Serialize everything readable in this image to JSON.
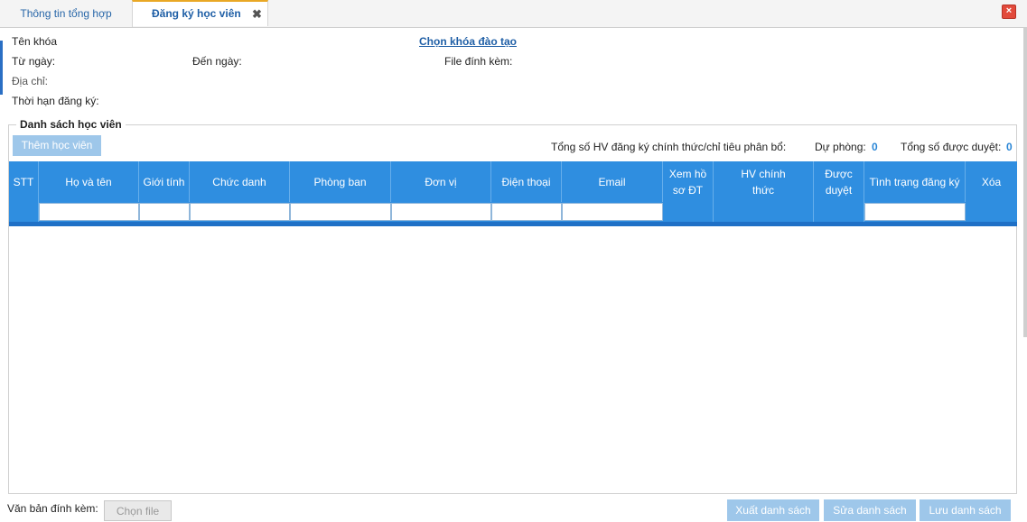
{
  "tabs": [
    {
      "label": "Thông tin tổng hợp"
    },
    {
      "label": "Đăng ký học viên"
    }
  ],
  "icons": {
    "tab_close": "close-icon",
    "window_close": "window-close-icon"
  },
  "info": {
    "course_label": "Tên khóa",
    "choose_course_link": "Chọn khóa đào tạo",
    "from_date_label": "Từ ngày:",
    "to_date_label": "Đến ngày:",
    "attachment_label": "File đính kèm:",
    "address_label": "Địa chỉ:",
    "deadline_label": "Thời hạn đăng ký:"
  },
  "student_list": {
    "legend": "Danh sách học viên",
    "add_button": "Thêm học viên",
    "summary": {
      "official_label": "Tổng số HV đăng ký chính thức/chỉ tiêu phân bổ:",
      "reserve_label": "Dự phòng:",
      "reserve_value": "0",
      "approved_label": "Tổng số được duyệt:",
      "approved_value": "0"
    },
    "columns": [
      "STT",
      "Họ và tên",
      "Giới tính",
      "Chức danh",
      "Phòng ban",
      "Đơn vị",
      "Điện thoại",
      "Email",
      "Xem hồ sơ ĐT",
      "HV chính thức",
      "Được duyệt",
      "Tình trạng đăng ký",
      "Xóa"
    ]
  },
  "footer": {
    "attached_doc_label": "Văn bản đính kèm:",
    "choose_file_button": "Chọn file",
    "export_button": "Xuất danh sách",
    "edit_button": "Sửa danh sách",
    "save_button": "Lưu danh sách"
  },
  "colors": {
    "header_blue": "#2f8ee0",
    "active_tab_accent": "#e9a825",
    "link": "#1f5fa6",
    "button": "#9ec7ea"
  }
}
